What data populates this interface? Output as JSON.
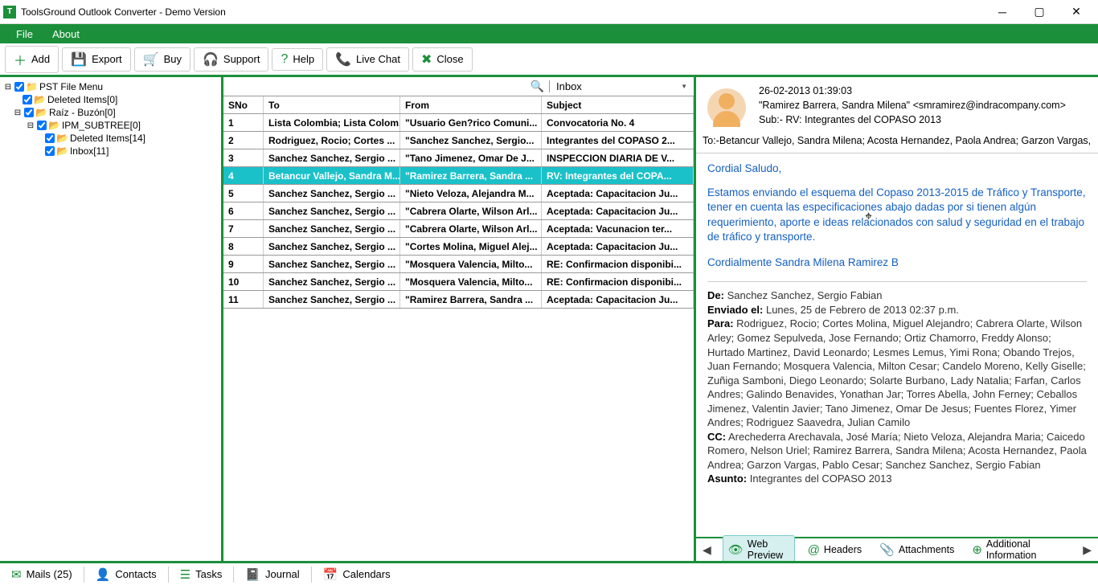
{
  "title": "ToolsGround Outlook Converter - Demo Version",
  "menu": {
    "file": "File",
    "about": "About"
  },
  "toolbar": {
    "add": "Add",
    "export": "Export",
    "buy": "Buy",
    "support": "Support",
    "help": "Help",
    "livechat": "Live Chat",
    "close": "Close"
  },
  "tree": {
    "root": "PST File Menu",
    "n1": "Deleted Items[0]",
    "n2": "Raíz - Buzón[0]",
    "n3": "IPM_SUBTREE[0]",
    "n4": "Deleted Items[14]",
    "n5": "Inbox[11]"
  },
  "list": {
    "folder": "Inbox",
    "cols": {
      "sno": "SNo",
      "to": "To",
      "from": "From",
      "subject": "Subject"
    },
    "rows": [
      {
        "sno": "1",
        "to": "Lista Colombia; Lista Colom...",
        "from": "\"Usuario Gen?rico Comuni...",
        "subject": "Convocatoria No. 4"
      },
      {
        "sno": "2",
        "to": "Rodriguez, Rocio; Cortes ...",
        "from": "\"Sanchez Sanchez, Sergio...",
        "subject": "Integrantes del COPASO 2..."
      },
      {
        "sno": "3",
        "to": "Sanchez Sanchez, Sergio ...",
        "from": "\"Tano Jimenez, Omar De J...",
        "subject": "INSPECCION DIARIA DE V..."
      },
      {
        "sno": "4",
        "to": "Betancur Vallejo, Sandra M...",
        "from": "\"Ramirez Barrera, Sandra ...",
        "subject": "RV: Integrantes del COPA..."
      },
      {
        "sno": "5",
        "to": "Sanchez Sanchez, Sergio ...",
        "from": "\"Nieto Veloza, Alejandra M...",
        "subject": "Aceptada: Capacitacion Ju..."
      },
      {
        "sno": "6",
        "to": "Sanchez Sanchez, Sergio ...",
        "from": "\"Cabrera Olarte, Wilson Arl...",
        "subject": "Aceptada: Capacitacion Ju..."
      },
      {
        "sno": "7",
        "to": "Sanchez Sanchez, Sergio ...",
        "from": "\"Cabrera Olarte, Wilson Arl...",
        "subject": "Aceptada: Vacunacion ter..."
      },
      {
        "sno": "8",
        "to": "Sanchez Sanchez, Sergio ...",
        "from": "\"Cortes Molina, Miguel Alej...",
        "subject": "Aceptada: Capacitacion Ju..."
      },
      {
        "sno": "9",
        "to": "Sanchez Sanchez, Sergio ...",
        "from": "\"Mosquera Valencia, Milto...",
        "subject": "RE: Confirmacion disponibi..."
      },
      {
        "sno": "10",
        "to": "Sanchez Sanchez, Sergio ...",
        "from": "\"Mosquera Valencia, Milto...",
        "subject": "RE: Confirmacion disponibi..."
      },
      {
        "sno": "11",
        "to": "Sanchez Sanchez, Sergio ...",
        "from": "\"Ramirez Barrera, Sandra ...",
        "subject": "Aceptada: Capacitacion Ju..."
      }
    ],
    "selected": 3
  },
  "preview": {
    "date": "26-02-2013 01:39:03",
    "from": "\"Ramirez Barrera, Sandra Milena\" <smramirez@indracompany.com>",
    "sub_label": "Sub:- ",
    "subject": "RV: Integrantes del COPASO 2013",
    "to_label": "To:-",
    "to": "Betancur Vallejo, Sandra Milena; Acosta Hernandez, Paola Andrea; Garzon Vargas, Pal",
    "greet": "Cordial Saludo,",
    "body1": "Estamos enviando el esquema del Copaso 2013-2015 de Tráfico y Transporte, tener en cuenta las especificaciones abajo dadas por si tienen algún requerimiento, aporte e ideas relacionados con salud y seguridad en el trabajo de tráfico y transporte.",
    "body2": "Cordialmente Sandra Milena Ramirez B",
    "de_l": "De:",
    "de_v": " Sanchez Sanchez, Sergio Fabian",
    "env_l": "Enviado el:",
    "env_v": " Lunes, 25 de Febrero de 2013 02:37 p.m.",
    "para_l": "Para:",
    "para_v": " Rodriguez, Rocio; Cortes Molina, Miguel Alejandro; Cabrera Olarte, Wilson Arley; Gomez Sepulveda, Jose Fernando; Ortiz Chamorro, Freddy Alonso; Hurtado Martinez, David Leonardo; Lesmes Lemus, Yimi Rona; Obando Trejos, Juan Fernando; Mosquera Valencia, Milton Cesar; Candelo Moreno, Kelly Giselle; Zuñiga Samboni, Diego Leonardo; Solarte Burbano, Lady Natalia; Farfan, Carlos Andres; Galindo Benavides, Yonathan Jar; Torres Abella, John Ferney; Ceballos Jimenez, Valentin Javier; Tano Jimenez, Omar De Jesus; Fuentes Florez, Yimer Andres; Rodriguez Saavedra, Julian Camilo",
    "cc_l": "CC:",
    "cc_v": " Arechederra Arechavala, José María; Nieto Veloza, Alejandra Maria; Caicedo Romero, Nelson Uriel; Ramirez Barrera, Sandra Milena; Acosta Hernandez, Paola Andrea; Garzon Vargas, Pablo Cesar; Sanchez Sanchez, Sergio Fabian",
    "asunto_l": "Asunto:",
    "asunto_v": " Integrantes del COPASO 2013",
    "tabs": {
      "web": "Web Preview",
      "headers": "Headers",
      "attach": "Attachments",
      "addl": "Additional Information"
    }
  },
  "bottom": {
    "mails": "Mails (25)",
    "contacts": "Contacts",
    "tasks": "Tasks",
    "journal": "Journal",
    "calendars": "Calendars"
  }
}
